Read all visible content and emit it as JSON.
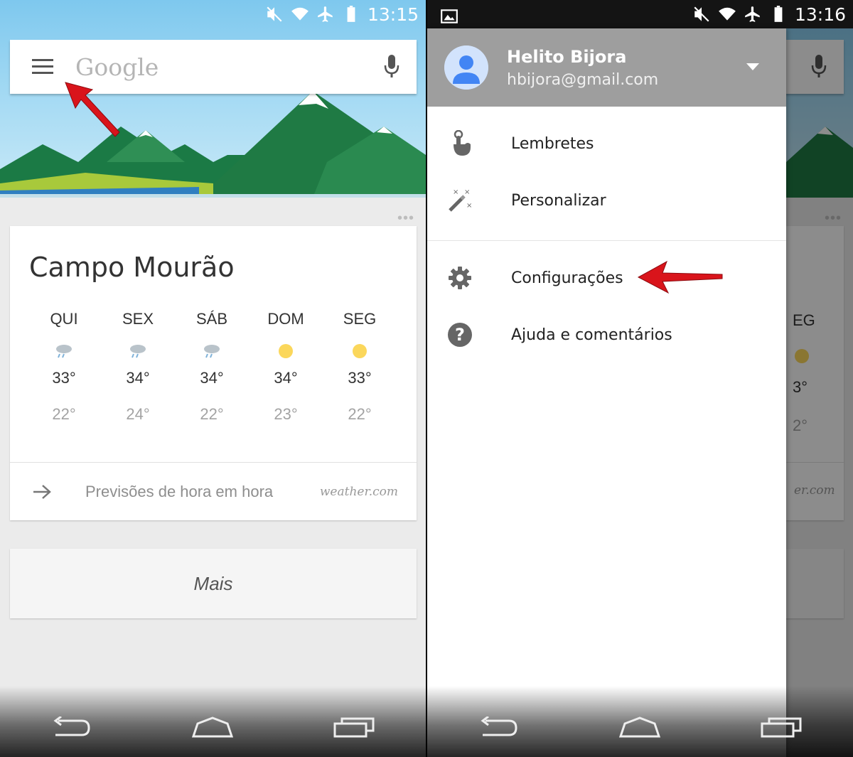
{
  "left_screen": {
    "status": {
      "time": "13:15"
    },
    "search": {
      "logo_text": "Google"
    },
    "weather": {
      "city": "Campo Mourão",
      "days": [
        {
          "name": "QUI",
          "icon": "rain-cloud-icon",
          "high": "33°",
          "low": "22°"
        },
        {
          "name": "SEX",
          "icon": "rain-cloud-icon",
          "high": "34°",
          "low": "24°"
        },
        {
          "name": "SÁB",
          "icon": "rain-cloud-icon",
          "high": "34°",
          "low": "22°"
        },
        {
          "name": "DOM",
          "icon": "sun-icon",
          "high": "34°",
          "low": "23°"
        },
        {
          "name": "SEG",
          "icon": "sun-icon",
          "high": "33°",
          "low": "22°"
        }
      ],
      "hourly_link": "Previsões de hora em hora",
      "source": "weather.com"
    },
    "more_label": "Mais"
  },
  "right_screen": {
    "status": {
      "time": "13:16"
    },
    "account": {
      "name": "Helito Bijora",
      "email": "hbijora@gmail.com"
    },
    "menu": {
      "primary": [
        {
          "label": "Lembretes",
          "icon": "reminder-hand-icon"
        },
        {
          "label": "Personalizar",
          "icon": "magic-wand-icon"
        }
      ],
      "secondary": [
        {
          "label": "Configurações",
          "icon": "gear-icon"
        },
        {
          "label": "Ajuda e comentários",
          "icon": "help-icon"
        }
      ]
    },
    "underlay": {
      "day_fragment": "EG",
      "high_fragment": "3°",
      "low_fragment": "2°",
      "source_fragment": "er.com"
    }
  },
  "colors": {
    "annotation_arrow": "#d9141b",
    "sun": "#fbd75b",
    "drawer_header": "#9e9e9e",
    "avatar_blue": "#4285f4"
  }
}
